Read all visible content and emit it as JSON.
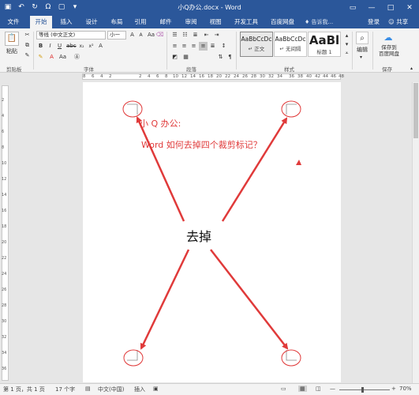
{
  "window": {
    "title": "小Q办公.docx - Word"
  },
  "tabs": {
    "file": "文件",
    "home": "开始",
    "insert": "插入",
    "design": "设计",
    "layout": "布局",
    "references": "引用",
    "mailings": "邮件",
    "review": "审阅",
    "view": "视图",
    "developer": "开发工具",
    "baidu": "百度网盘"
  },
  "tell_me": "告诉我...",
  "account": {
    "login": "登录",
    "share": "共享"
  },
  "ribbon": {
    "clipboard": {
      "paste": "粘贴",
      "label": "剪贴板"
    },
    "font": {
      "font_name": "等线 (中文正文)",
      "font_size": "小一",
      "label": "字体"
    },
    "paragraph": {
      "label": "段落"
    },
    "styles": {
      "label": "样式",
      "items": [
        {
          "sample": "AaBbCcDc",
          "name": "正文"
        },
        {
          "sample": "AaBbCcDc",
          "name": "无间隔"
        },
        {
          "sample": "AaBl",
          "name": "标题 1"
        }
      ]
    },
    "editing": {
      "label": "编辑"
    },
    "save": {
      "label": "保存到百度网盘",
      "line1": "保存到",
      "line2": "百度网盘",
      "group": "保存"
    }
  },
  "ruler": {
    "numbers": [
      "2",
      "4",
      "6",
      "8",
      "10",
      "12",
      "14",
      "16",
      "18",
      "20",
      "22",
      "24",
      "26",
      "28",
      "30",
      "32",
      "34",
      "36",
      "38",
      "40",
      "42",
      "44",
      "46",
      "48"
    ]
  },
  "vruler": {
    "numbers": [
      "2",
      "4",
      "6",
      "8",
      "10",
      "12",
      "14",
      "16",
      "18",
      "20",
      "22",
      "24",
      "26",
      "28",
      "30",
      "32",
      "34",
      "36"
    ]
  },
  "document": {
    "line1": "小 Q 办公:",
    "line2": "Word 如何去掉四个裁剪标记？",
    "annotation": "去掉"
  },
  "colors": {
    "brand": "#2b579a",
    "annotation": "#e03a3a"
  },
  "status": {
    "page": "第 1 页，共 1 页",
    "words": "17 个字",
    "language": "中文(中国)",
    "mode": "插入",
    "zoom": "70%"
  }
}
